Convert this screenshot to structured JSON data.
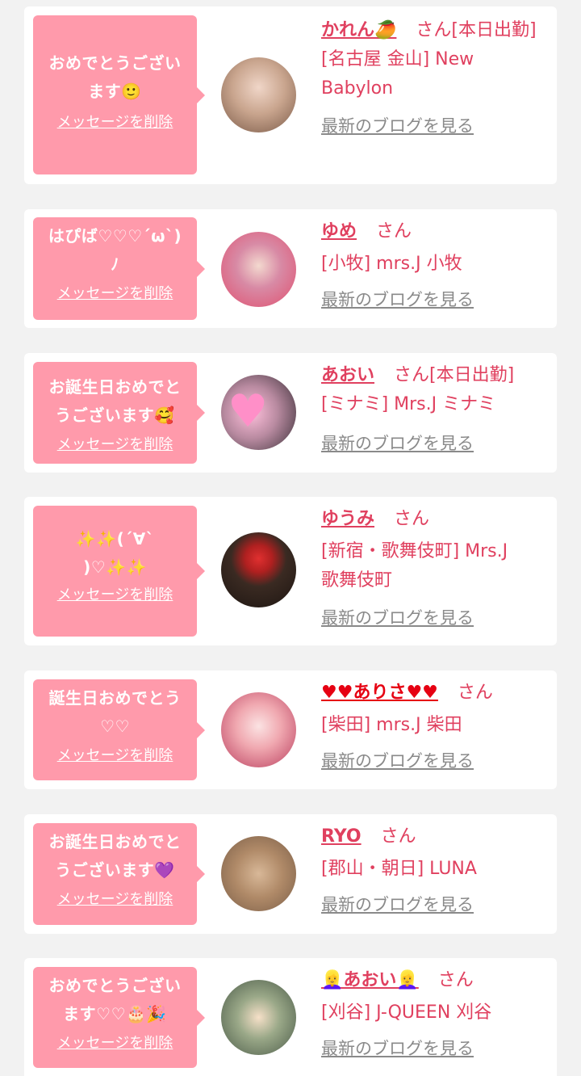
{
  "san": "さん",
  "delete_label": "メッセージを削除",
  "blog_label": "最新のブログを見る",
  "cards": [
    {
      "message_lines": [
        "おめでとうござい",
        "ます🙂"
      ],
      "name": "かれん🥭",
      "status": "[本日出勤]",
      "shop_lines": [
        "[名古屋 金山] New",
        "Babylon"
      ]
    },
    {
      "message_lines": [
        "はぴば♡♡♡´ω`)",
        "ﾉ"
      ],
      "name": "ゆめ",
      "status": "",
      "shop_lines": [
        "[小牧] mrs.J 小牧"
      ]
    },
    {
      "message_lines": [
        "お誕生日おめでと",
        "うございます🥰"
      ],
      "name": "あおい",
      "status": "[本日出勤]",
      "shop_lines": [
        "[ミナミ] Mrs.J ミナミ"
      ]
    },
    {
      "message_lines": [
        "✨✨(´∀`",
        ")♡✨✨"
      ],
      "name": "ゆうみ",
      "status": "",
      "shop_lines": [
        "[新宿・歌舞伎町] Mrs.J",
        "歌舞伎町"
      ]
    },
    {
      "message_lines": [
        "誕生日おめでとう",
        "♡♡"
      ],
      "name": "♥♥ありさ♥♥",
      "status": "",
      "shop_lines": [
        "[柴田] mrs.J 柴田"
      ]
    },
    {
      "message_lines": [
        "お誕生日おめでと",
        "うございます💜"
      ],
      "name": "RYO",
      "status": "",
      "shop_lines": [
        "[郡山・朝日] LUNA"
      ]
    },
    {
      "message_lines": [
        "おめでとうござい",
        "ます♡♡🎂🎉"
      ],
      "name": "👱‍♀️あおい👱‍♀️",
      "status": "",
      "shop_lines": [
        "[刈谷] J-QUEEN 刈谷"
      ]
    }
  ],
  "colors": {
    "bubble": "#ff9aab",
    "accent": "#e0405f",
    "link_gray": "#8a8a8a",
    "background": "#f2f2f2"
  }
}
